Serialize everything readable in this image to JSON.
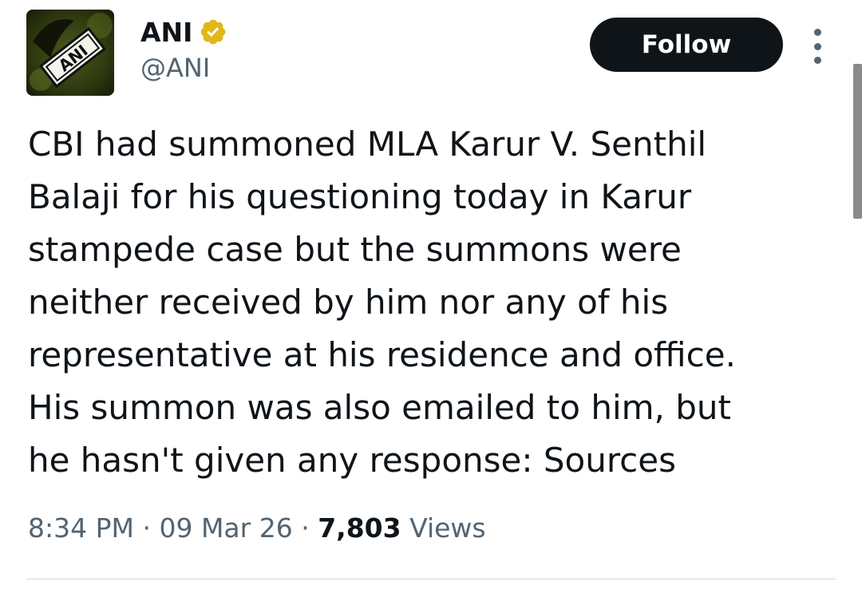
{
  "author": {
    "display_name": "ANI",
    "handle": "@ANI",
    "avatar_text": "ANI",
    "verified": true,
    "verified_badge_color": "#e2b719"
  },
  "actions": {
    "follow_label": "Follow",
    "more_icon": "more-vertical-icon"
  },
  "tweet": {
    "lines": [
      "CBI had summoned MLA Karur V. Senthil",
      "Balaji for his questioning today in Karur",
      "stampede case but the summons were",
      "neither received by him nor any of his",
      "representative at his residence and office.",
      "His summon was also emailed to him, but",
      "he hasn't given any response: Sources"
    ]
  },
  "meta": {
    "time": "8:34 PM",
    "separator": "·",
    "date": "09 Mar 26",
    "views_count": "7,803",
    "views_label": "Views"
  },
  "colors": {
    "text_primary": "#0f1419",
    "text_secondary": "#536471",
    "button_bg": "#0f1419",
    "divider": "#cfd9de"
  }
}
